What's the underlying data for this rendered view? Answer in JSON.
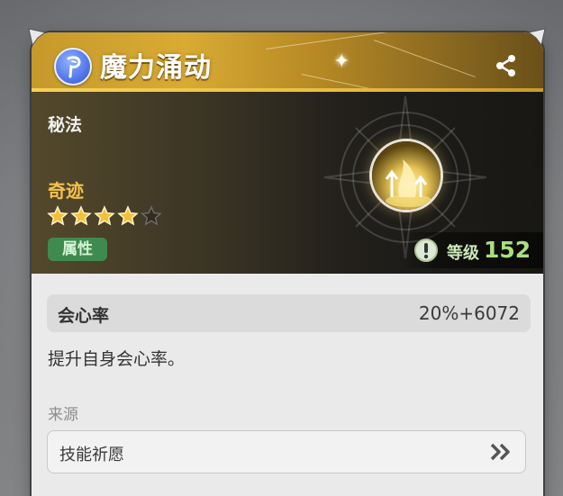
{
  "card": {
    "title": "魔力涌动",
    "title_icon": "rune-p-icon",
    "share_icon": "share-icon",
    "category": "秘法",
    "rarity_label": "奇迹",
    "stars": {
      "filled": 4,
      "total": 5
    },
    "attribute_badge": "属性",
    "skill_icon": "golden-flame-arrows-icon",
    "level": {
      "label": "等级",
      "value": "152",
      "info_icon": "exclamation-icon"
    }
  },
  "stat": {
    "name": "会心率",
    "value": "20%+6072"
  },
  "description": "提升自身会心率。",
  "source": {
    "label": "来源",
    "item": "技能祈愿",
    "arrow_icon": "double-chevron-right-icon"
  },
  "colors": {
    "header_gold": "#d9ab34",
    "rarity_gold": "#f4c24a",
    "attribute_green": "#3f8a4e",
    "level_green": "#a9e07e",
    "title_icon_blue": "#4a6ee6"
  }
}
